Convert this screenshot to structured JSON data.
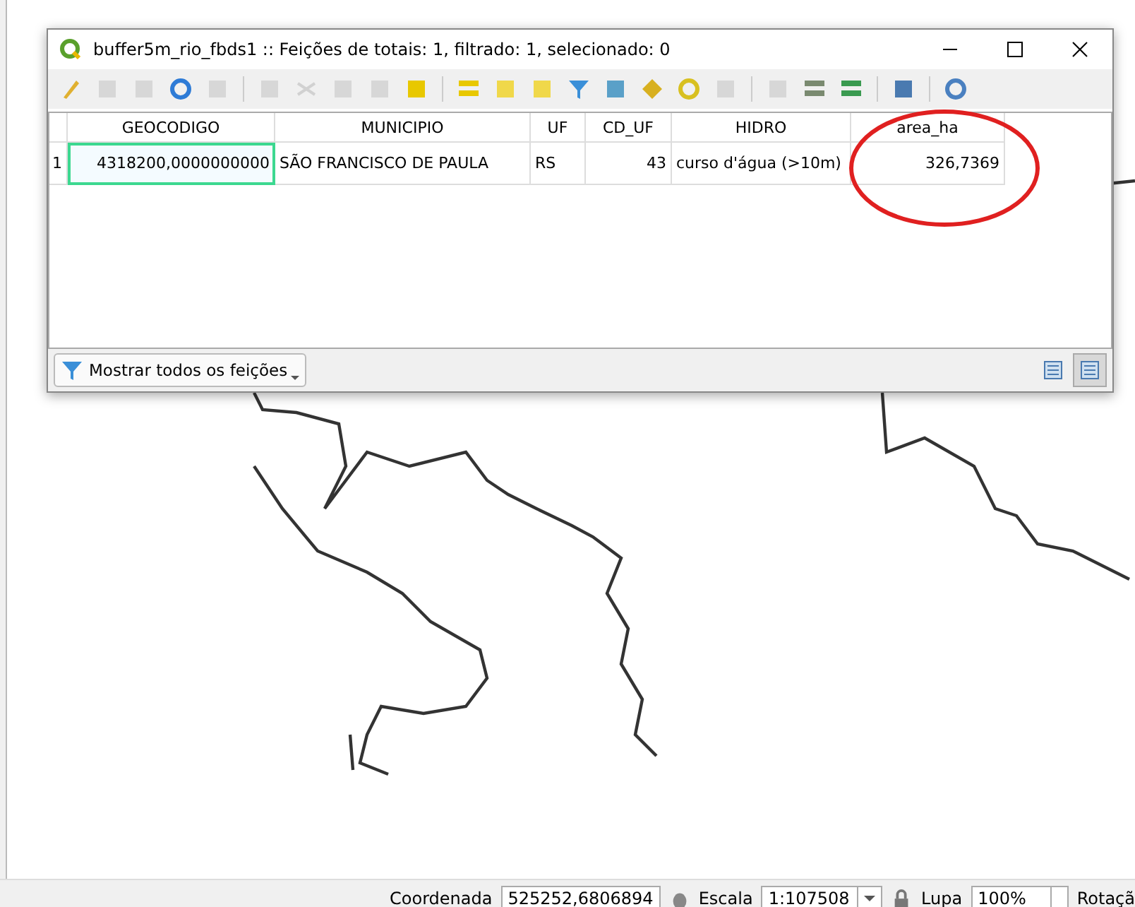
{
  "window": {
    "title": "buffer5m_rio_fbds1 :: Feições de totais: 1, filtrado: 1, selecionado: 0"
  },
  "toolbar": [
    {
      "disabled": false
    },
    {
      "disabled": true
    },
    {
      "disabled": true
    },
    {
      "disabled": false
    },
    {
      "disabled": true
    },
    {
      "disabled": true
    },
    {
      "disabled": true
    },
    {
      "disabled": true
    },
    {
      "disabled": true
    },
    {
      "disabled": false
    },
    {
      "disabled": false
    },
    {
      "disabled": false
    },
    {
      "disabled": false
    },
    {
      "disabled": false
    },
    {
      "disabled": false
    },
    {
      "disabled": false
    },
    {
      "disabled": false
    },
    {
      "disabled": true
    },
    {
      "disabled": true
    },
    {
      "disabled": false
    },
    {
      "disabled": false
    },
    {
      "disabled": false
    },
    {
      "disabled": false
    }
  ],
  "table": {
    "columns": [
      "GEOCODIGO",
      "MUNICIPIO",
      "UF",
      "CD_UF",
      "HIDRO",
      "area_ha"
    ],
    "rows": [
      {
        "number": "1",
        "cells": [
          {
            "text": "4318200,0000000000",
            "selected": true
          },
          {
            "text": "SÃO FRANCISCO DE PAULA",
            "selected": false
          },
          {
            "text": "RS",
            "selected": false
          },
          {
            "text": "43",
            "selected": false
          },
          {
            "text": "curso d'água (>10m)",
            "selected": false
          },
          {
            "text": "326,7369",
            "selected": false
          }
        ]
      }
    ]
  },
  "filter_button": {
    "label": "Mostrar todos os feições"
  },
  "view_modes": [
    {
      "selected": false
    },
    {
      "selected": true
    }
  ],
  "status_bar": {
    "coordinate_label": "Coordenada",
    "coordinate": "525252,6806894",
    "scale_label": "Escala",
    "scale": "1:107508",
    "magnifier_label": "Lupa",
    "magnifier": "100%",
    "rotation_label": "Rotaçã"
  }
}
